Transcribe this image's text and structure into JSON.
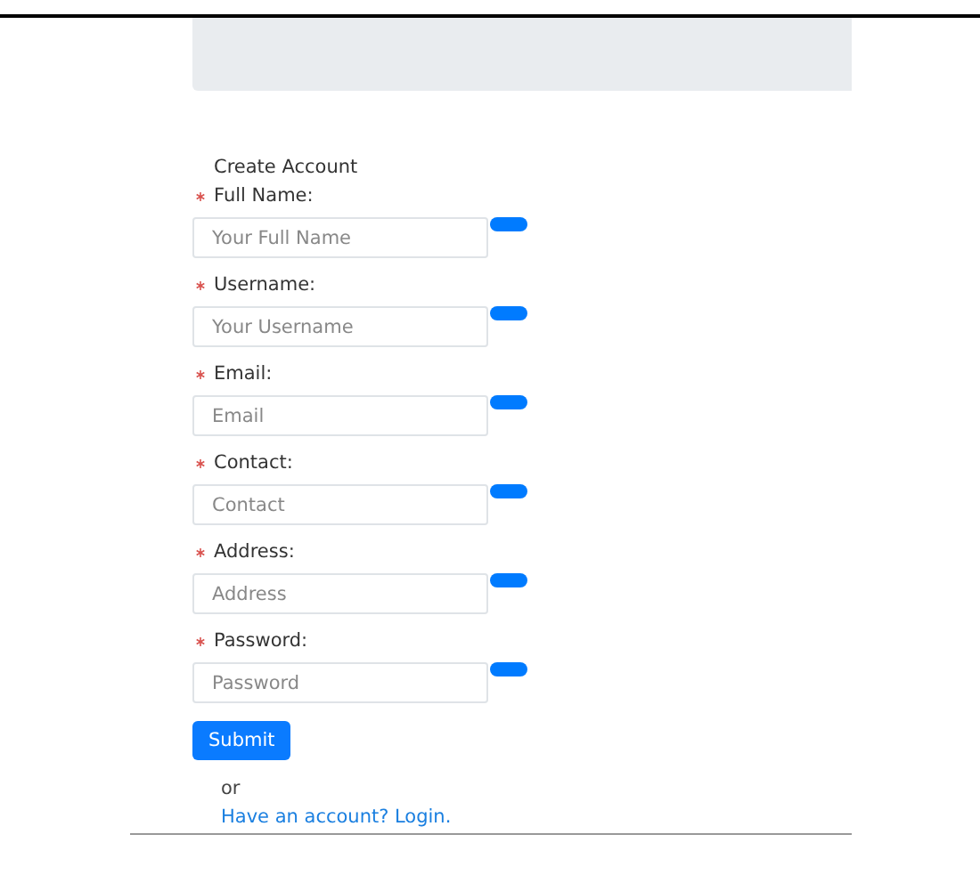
{
  "form": {
    "title": "Create Account",
    "fields": [
      {
        "label": "Full Name:",
        "placeholder": "Your Full Name",
        "required": true
      },
      {
        "label": "Username:",
        "placeholder": "Your Username",
        "required": true
      },
      {
        "label": "Email:",
        "placeholder": "Email",
        "required": true
      },
      {
        "label": "Contact:",
        "placeholder": "Contact",
        "required": true
      },
      {
        "label": "Address:",
        "placeholder": "Address",
        "required": true
      },
      {
        "label": "Password:",
        "placeholder": "Password",
        "required": true
      }
    ],
    "submit": "Submit",
    "or": "or",
    "login_link": "Have an account? Login."
  }
}
